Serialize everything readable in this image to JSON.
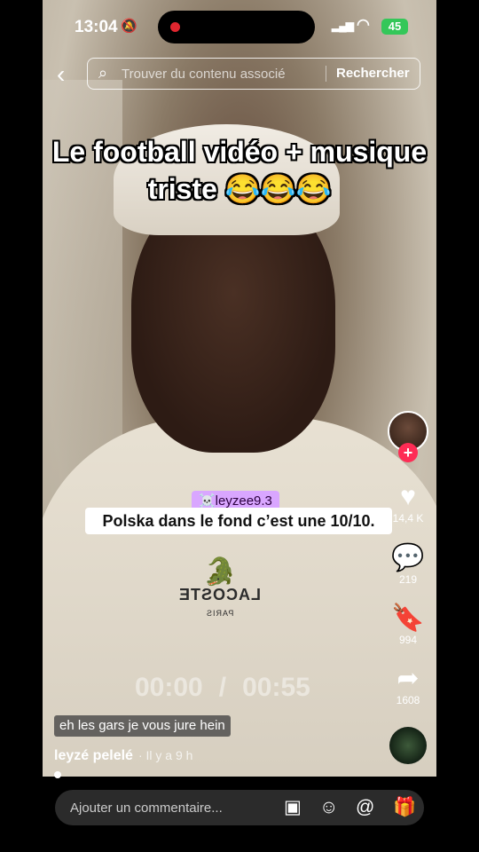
{
  "status": {
    "time": "13:04",
    "battery": "45"
  },
  "search": {
    "placeholder": "Trouver du contenu associé",
    "button": "Rechercher"
  },
  "caption": "Le football vidéo + musique triste 😂😂😂",
  "video": {
    "mention": "☠️leyzee9.3",
    "quote": "Polska dans le fond c’est une 10/10.",
    "timer_current": "00:00",
    "timer_total": "00:55",
    "subtitle": "eh les gars je vous jure hein",
    "shirt_brand": "LACOSTE",
    "shirt_city": "PARIS"
  },
  "author": {
    "name": "leyzé pelelé",
    "time": "· Il y a 9 h"
  },
  "actions": {
    "likes": "14,4 K",
    "comments": "219",
    "saves": "994",
    "shares": "1608"
  },
  "comment_bar": {
    "placeholder": "Ajouter un commentaire..."
  }
}
